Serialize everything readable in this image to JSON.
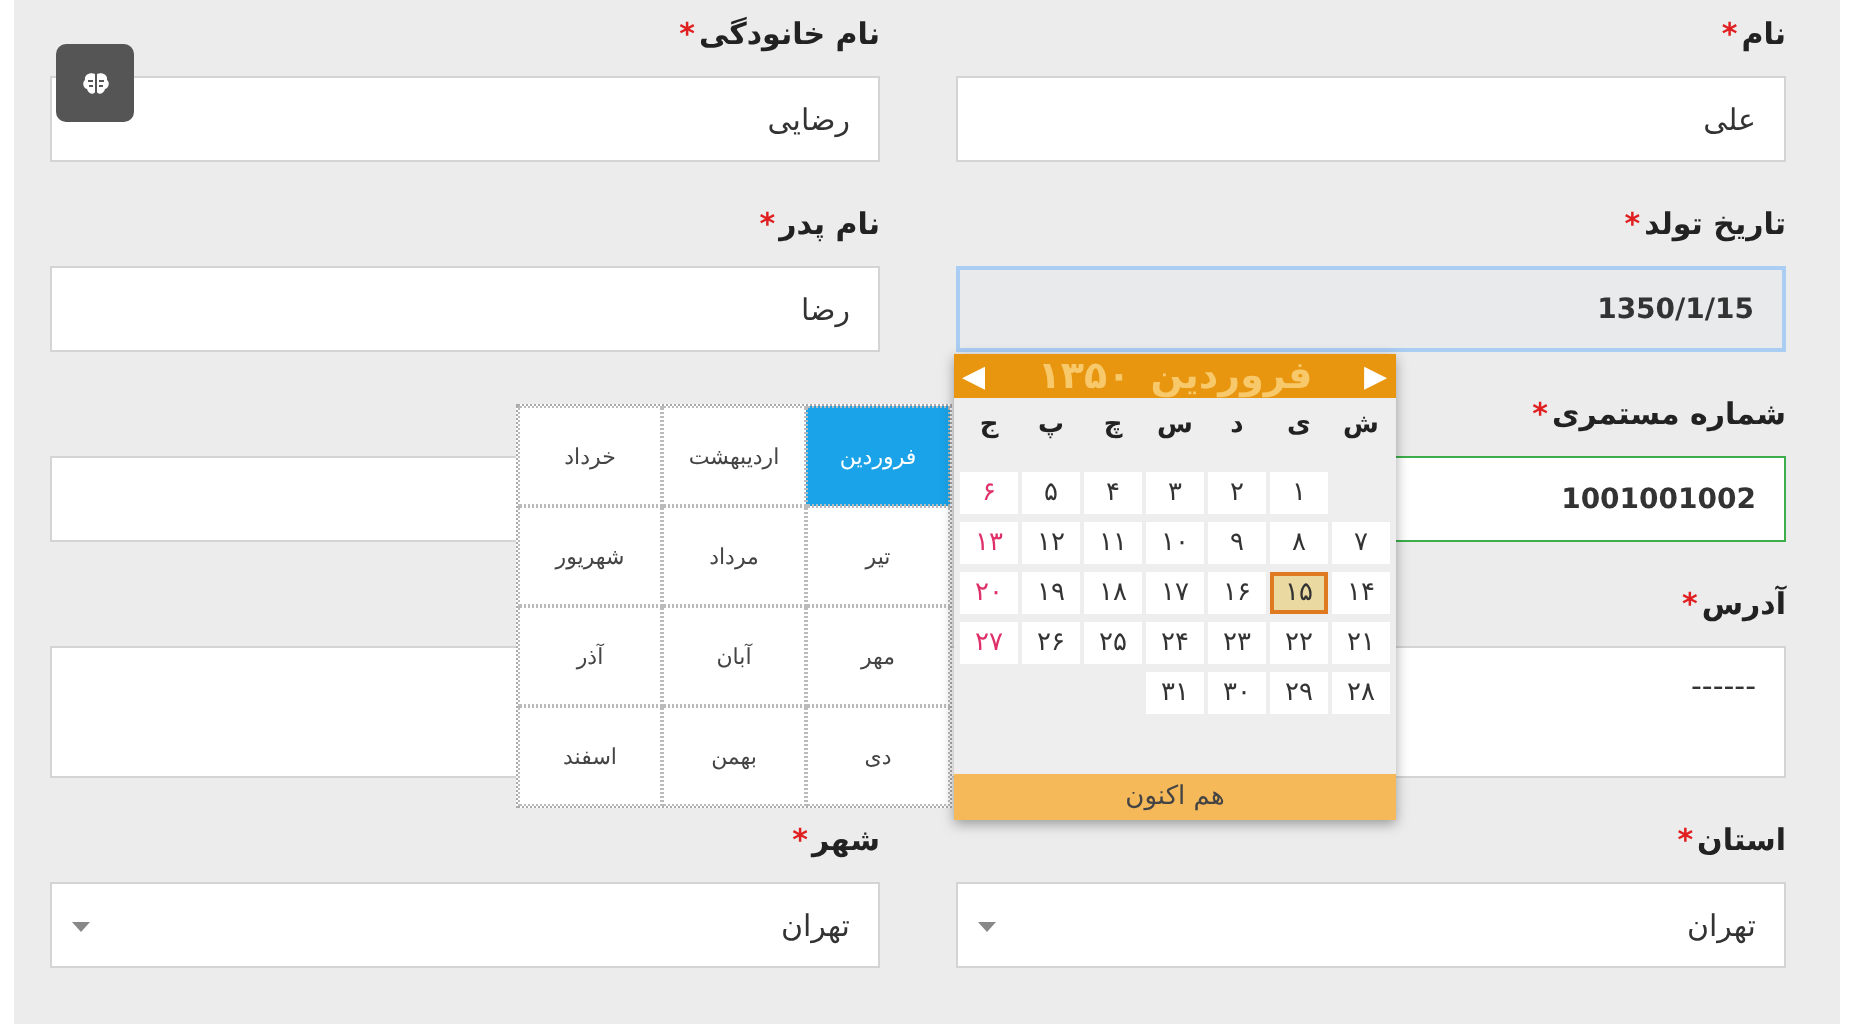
{
  "assist_button": {
    "kind": "brain"
  },
  "fields": [
    {
      "label": "نام",
      "required_mark": "*",
      "kind": "text",
      "value": "علی",
      "focused": false,
      "valid": false
    },
    {
      "label": "نام خانودگی",
      "required_mark": "*",
      "kind": "text",
      "value": "رضایی",
      "focused": false,
      "valid": false
    },
    {
      "label": "تاریخ تولد",
      "required_mark": "*",
      "kind": "text",
      "value": "1350/1/15",
      "focused": true,
      "valid": false
    },
    {
      "label": "نام پدر",
      "required_mark": "*",
      "kind": "text",
      "value": "رضا",
      "focused": false,
      "valid": false
    },
    {
      "label": "شماره مستمری",
      "required_mark": "*",
      "kind": "text",
      "value": "1001001002",
      "focused": false,
      "valid": true
    },
    {
      "kind": "text",
      "focused": false,
      "valid": false
    },
    {
      "label": "آدرس",
      "required_mark": "*",
      "kind": "textarea",
      "value": "------",
      "focused": false,
      "valid": false
    },
    {
      "label": "استان",
      "required_mark": "*",
      "kind": "select",
      "value": "تهران",
      "focused": false,
      "valid": false
    },
    {
      "label": "شهر",
      "required_mark": "*",
      "kind": "select",
      "value": "تهران",
      "focused": false,
      "valid": false
    }
  ],
  "calendar": {
    "prev": "◀",
    "next": "▶",
    "month": "فروردین",
    "year": "۱۳۵۰",
    "weekdays": [
      "ش",
      "ی",
      "د",
      "س",
      "چ",
      "پ",
      "ج"
    ],
    "days": [
      {
        "kind": "blank"
      },
      {
        "kind": "day",
        "label": "۱",
        "selected": false,
        "holiday": false
      },
      {
        "kind": "day",
        "label": "۲",
        "selected": false,
        "holiday": false
      },
      {
        "kind": "day",
        "label": "۳",
        "selected": false,
        "holiday": false
      },
      {
        "kind": "day",
        "label": "۴",
        "selected": false,
        "holiday": false
      },
      {
        "kind": "day",
        "label": "۵",
        "selected": false,
        "holiday": false
      },
      {
        "kind": "day",
        "label": "۶",
        "selected": false,
        "holiday": true
      },
      {
        "kind": "day",
        "label": "۷",
        "selected": false,
        "holiday": false
      },
      {
        "kind": "day",
        "label": "۸",
        "selected": false,
        "holiday": false
      },
      {
        "kind": "day",
        "label": "۹",
        "selected": false,
        "holiday": false
      },
      {
        "kind": "day",
        "label": "۱۰",
        "selected": false,
        "holiday": false
      },
      {
        "kind": "day",
        "label": "۱۱",
        "selected": false,
        "holiday": false
      },
      {
        "kind": "day",
        "label": "۱۲",
        "selected": false,
        "holiday": false
      },
      {
        "kind": "day",
        "label": "۱۳",
        "selected": false,
        "holiday": true
      },
      {
        "kind": "day",
        "label": "۱۴",
        "selected": false,
        "holiday": false
      },
      {
        "kind": "day",
        "label": "۱۵",
        "selected": true,
        "holiday": false
      },
      {
        "kind": "day",
        "label": "۱۶",
        "selected": false,
        "holiday": false
      },
      {
        "kind": "day",
        "label": "۱۷",
        "selected": false,
        "holiday": false
      },
      {
        "kind": "day",
        "label": "۱۸",
        "selected": false,
        "holiday": false
      },
      {
        "kind": "day",
        "label": "۱۹",
        "selected": false,
        "holiday": false
      },
      {
        "kind": "day",
        "label": "۲۰",
        "selected": false,
        "holiday": true
      },
      {
        "kind": "day",
        "label": "۲۱",
        "selected": false,
        "holiday": false
      },
      {
        "kind": "day",
        "label": "۲۲",
        "selected": false,
        "holiday": false
      },
      {
        "kind": "day",
        "label": "۲۳",
        "selected": false,
        "holiday": false
      },
      {
        "kind": "day",
        "label": "۲۴",
        "selected": false,
        "holiday": false
      },
      {
        "kind": "day",
        "label": "۲۵",
        "selected": false,
        "holiday": false
      },
      {
        "kind": "day",
        "label": "۲۶",
        "selected": false,
        "holiday": false
      },
      {
        "kind": "day",
        "label": "۲۷",
        "selected": false,
        "holiday": true
      },
      {
        "kind": "day",
        "label": "۲۸",
        "selected": false,
        "holiday": false
      },
      {
        "kind": "day",
        "label": "۲۹",
        "selected": false,
        "holiday": false
      },
      {
        "kind": "day",
        "label": "۳۰",
        "selected": false,
        "holiday": false
      },
      {
        "kind": "day",
        "label": "۳۱",
        "selected": false,
        "holiday": false
      }
    ],
    "now_button": "هم اکنون"
  },
  "month_picker": [
    {
      "label": "فروردین",
      "selected": true
    },
    {
      "label": "اردیبهشت",
      "selected": false
    },
    {
      "label": "خرداد",
      "selected": false
    },
    {
      "label": "تیر",
      "selected": false
    },
    {
      "label": "مرداد",
      "selected": false
    },
    {
      "label": "شهریور",
      "selected": false
    },
    {
      "label": "مهر",
      "selected": false
    },
    {
      "label": "آبان",
      "selected": false
    },
    {
      "label": "آذر",
      "selected": false
    },
    {
      "label": "دی",
      "selected": false
    },
    {
      "label": "بهمن",
      "selected": false
    },
    {
      "label": "اسفند",
      "selected": false
    }
  ]
}
